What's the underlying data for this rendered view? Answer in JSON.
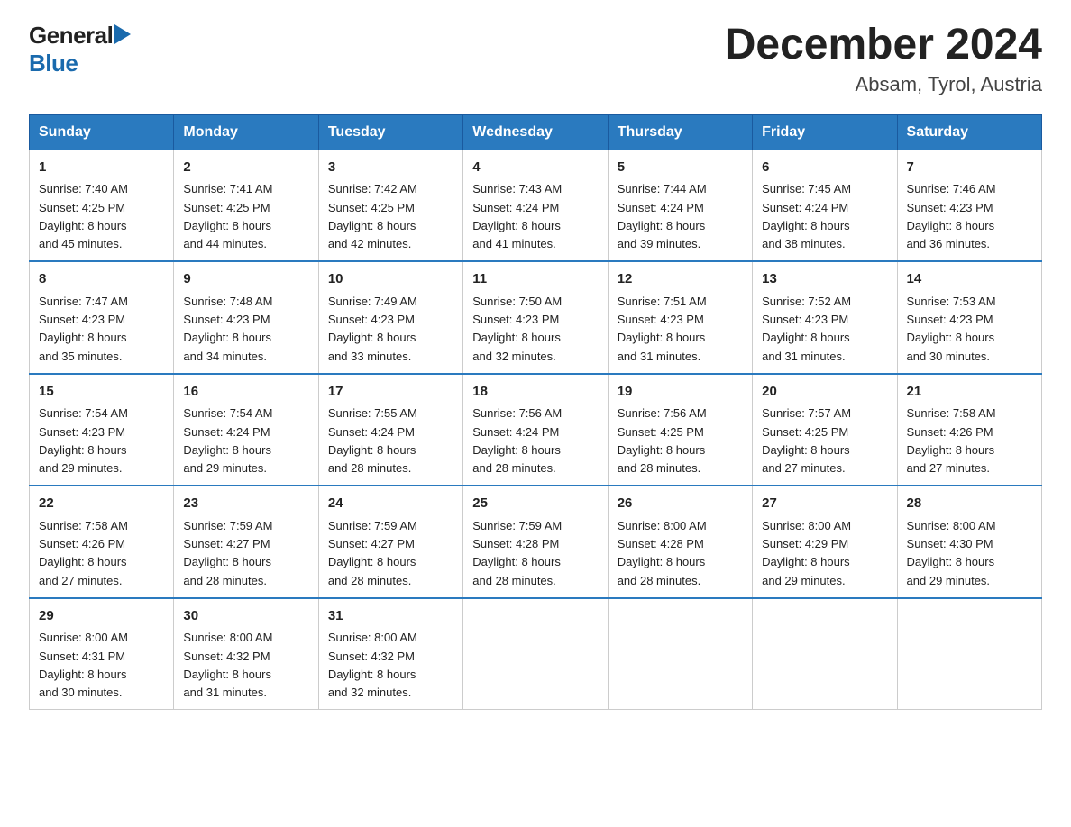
{
  "header": {
    "logo_line1": "General",
    "logo_arrow": "▶",
    "logo_line2": "Blue",
    "title": "December 2024",
    "subtitle": "Absam, Tyrol, Austria"
  },
  "days_of_week": [
    "Sunday",
    "Monday",
    "Tuesday",
    "Wednesday",
    "Thursday",
    "Friday",
    "Saturday"
  ],
  "weeks": [
    [
      {
        "day": "1",
        "sunrise": "7:40 AM",
        "sunset": "4:25 PM",
        "daylight": "8 hours and 45 minutes."
      },
      {
        "day": "2",
        "sunrise": "7:41 AM",
        "sunset": "4:25 PM",
        "daylight": "8 hours and 44 minutes."
      },
      {
        "day": "3",
        "sunrise": "7:42 AM",
        "sunset": "4:25 PM",
        "daylight": "8 hours and 42 minutes."
      },
      {
        "day": "4",
        "sunrise": "7:43 AM",
        "sunset": "4:24 PM",
        "daylight": "8 hours and 41 minutes."
      },
      {
        "day": "5",
        "sunrise": "7:44 AM",
        "sunset": "4:24 PM",
        "daylight": "8 hours and 39 minutes."
      },
      {
        "day": "6",
        "sunrise": "7:45 AM",
        "sunset": "4:24 PM",
        "daylight": "8 hours and 38 minutes."
      },
      {
        "day": "7",
        "sunrise": "7:46 AM",
        "sunset": "4:23 PM",
        "daylight": "8 hours and 36 minutes."
      }
    ],
    [
      {
        "day": "8",
        "sunrise": "7:47 AM",
        "sunset": "4:23 PM",
        "daylight": "8 hours and 35 minutes."
      },
      {
        "day": "9",
        "sunrise": "7:48 AM",
        "sunset": "4:23 PM",
        "daylight": "8 hours and 34 minutes."
      },
      {
        "day": "10",
        "sunrise": "7:49 AM",
        "sunset": "4:23 PM",
        "daylight": "8 hours and 33 minutes."
      },
      {
        "day": "11",
        "sunrise": "7:50 AM",
        "sunset": "4:23 PM",
        "daylight": "8 hours and 32 minutes."
      },
      {
        "day": "12",
        "sunrise": "7:51 AM",
        "sunset": "4:23 PM",
        "daylight": "8 hours and 31 minutes."
      },
      {
        "day": "13",
        "sunrise": "7:52 AM",
        "sunset": "4:23 PM",
        "daylight": "8 hours and 31 minutes."
      },
      {
        "day": "14",
        "sunrise": "7:53 AM",
        "sunset": "4:23 PM",
        "daylight": "8 hours and 30 minutes."
      }
    ],
    [
      {
        "day": "15",
        "sunrise": "7:54 AM",
        "sunset": "4:23 PM",
        "daylight": "8 hours and 29 minutes."
      },
      {
        "day": "16",
        "sunrise": "7:54 AM",
        "sunset": "4:24 PM",
        "daylight": "8 hours and 29 minutes."
      },
      {
        "day": "17",
        "sunrise": "7:55 AM",
        "sunset": "4:24 PM",
        "daylight": "8 hours and 28 minutes."
      },
      {
        "day": "18",
        "sunrise": "7:56 AM",
        "sunset": "4:24 PM",
        "daylight": "8 hours and 28 minutes."
      },
      {
        "day": "19",
        "sunrise": "7:56 AM",
        "sunset": "4:25 PM",
        "daylight": "8 hours and 28 minutes."
      },
      {
        "day": "20",
        "sunrise": "7:57 AM",
        "sunset": "4:25 PM",
        "daylight": "8 hours and 27 minutes."
      },
      {
        "day": "21",
        "sunrise": "7:58 AM",
        "sunset": "4:26 PM",
        "daylight": "8 hours and 27 minutes."
      }
    ],
    [
      {
        "day": "22",
        "sunrise": "7:58 AM",
        "sunset": "4:26 PM",
        "daylight": "8 hours and 27 minutes."
      },
      {
        "day": "23",
        "sunrise": "7:59 AM",
        "sunset": "4:27 PM",
        "daylight": "8 hours and 28 minutes."
      },
      {
        "day": "24",
        "sunrise": "7:59 AM",
        "sunset": "4:27 PM",
        "daylight": "8 hours and 28 minutes."
      },
      {
        "day": "25",
        "sunrise": "7:59 AM",
        "sunset": "4:28 PM",
        "daylight": "8 hours and 28 minutes."
      },
      {
        "day": "26",
        "sunrise": "8:00 AM",
        "sunset": "4:28 PM",
        "daylight": "8 hours and 28 minutes."
      },
      {
        "day": "27",
        "sunrise": "8:00 AM",
        "sunset": "4:29 PM",
        "daylight": "8 hours and 29 minutes."
      },
      {
        "day": "28",
        "sunrise": "8:00 AM",
        "sunset": "4:30 PM",
        "daylight": "8 hours and 29 minutes."
      }
    ],
    [
      {
        "day": "29",
        "sunrise": "8:00 AM",
        "sunset": "4:31 PM",
        "daylight": "8 hours and 30 minutes."
      },
      {
        "day": "30",
        "sunrise": "8:00 AM",
        "sunset": "4:32 PM",
        "daylight": "8 hours and 31 minutes."
      },
      {
        "day": "31",
        "sunrise": "8:00 AM",
        "sunset": "4:32 PM",
        "daylight": "8 hours and 32 minutes."
      },
      null,
      null,
      null,
      null
    ]
  ],
  "labels": {
    "sunrise": "Sunrise:",
    "sunset": "Sunset:",
    "daylight": "Daylight:"
  }
}
